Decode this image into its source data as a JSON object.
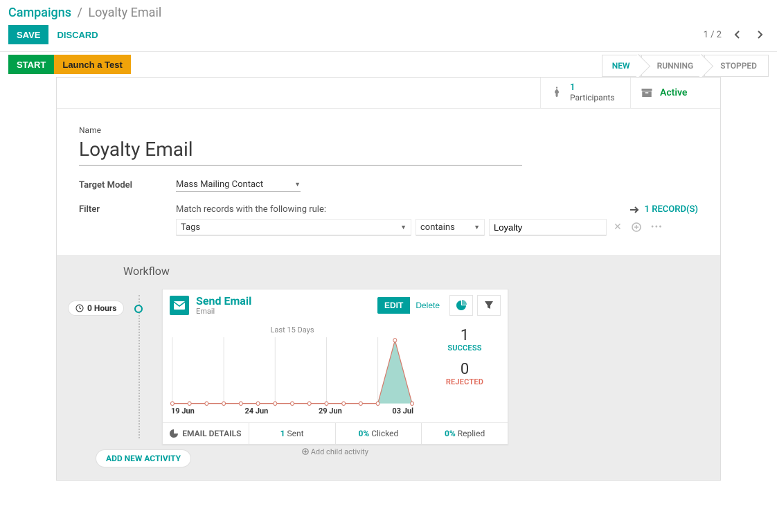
{
  "breadcrumb": {
    "root": "Campaigns",
    "sep": "/",
    "current": "Loyalty Email"
  },
  "actions": {
    "save": "SAVE",
    "discard": "DISCARD",
    "pager": "1 / 2"
  },
  "status_actions": {
    "start": "START",
    "launch_test": "Launch a Test"
  },
  "statusbar": {
    "new": "NEW",
    "running": "RUNNING",
    "stopped": "STOPPED"
  },
  "stats": {
    "participants_count": "1",
    "participants_label": "Participants",
    "active_label": "Active"
  },
  "form": {
    "name_label": "Name",
    "name_value": "Loyalty Email",
    "target_model_label": "Target Model",
    "target_model_value": "Mass Mailing Contact",
    "filter_label": "Filter",
    "filter_hint": "Match records with the following rule:",
    "records_link": "1 RECORD(S)",
    "filter_field": "Tags",
    "filter_op": "contains",
    "filter_value": "Loyalty"
  },
  "workflow": {
    "title": "Workflow",
    "time_badge": "0 Hours",
    "card": {
      "title": "Send Email",
      "subtitle": "Email",
      "edit": "EDIT",
      "delete": "Delete"
    },
    "stats": {
      "success_count": "1",
      "success_label": "SUCCESS",
      "rejected_count": "0",
      "rejected_label": "REJECTED"
    },
    "footer": {
      "details": "EMAIL DETAILS",
      "sent_num": "1",
      "sent_lbl": "Sent",
      "clicked_num": "0%",
      "clicked_lbl": "Clicked",
      "replied_num": "0%",
      "replied_lbl": "Replied"
    },
    "add_child": "Add child activity",
    "add_activity": "ADD NEW ACTIVITY"
  },
  "chart_data": {
    "type": "area",
    "title": "Last 15 Days",
    "xlabel": "",
    "ylabel": "",
    "categories": [
      "19 Jun",
      "20 Jun",
      "21 Jun",
      "22 Jun",
      "23 Jun",
      "24 Jun",
      "25 Jun",
      "26 Jun",
      "27 Jun",
      "28 Jun",
      "29 Jun",
      "30 Jun",
      "01 Jul",
      "02 Jul",
      "03 Jul"
    ],
    "values": [
      0,
      0,
      0,
      0,
      0,
      0,
      0,
      0,
      0,
      0,
      0,
      0,
      0,
      1,
      0
    ],
    "ylim": [
      0,
      1
    ],
    "xticks": [
      "19 Jun",
      "24 Jun",
      "29 Jun",
      "03 Jul"
    ]
  }
}
